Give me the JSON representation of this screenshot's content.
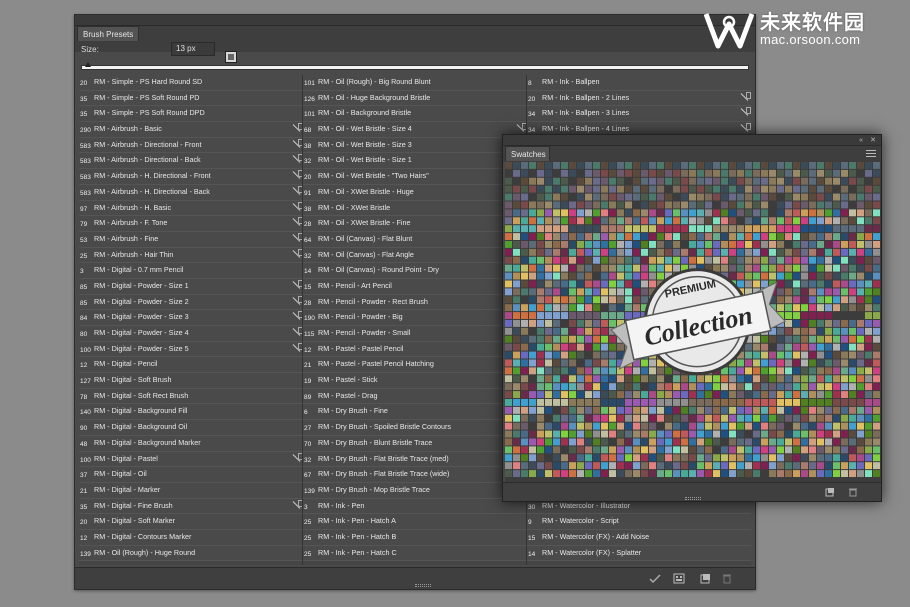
{
  "brush_panel": {
    "tab": "Brush Presets",
    "size_label": "Size:",
    "size_value": "13 px",
    "size_slider_fraction": 0.01,
    "columns": [
      [
        {
          "num": "20",
          "name": "RM - Simple - PS Hard Round SD",
          "flag": false
        },
        {
          "num": "35",
          "name": "RM - Simple - PS Soft Round PD",
          "flag": false
        },
        {
          "num": "35",
          "name": "RM - Simple - PS Soft Round DPD",
          "flag": false
        },
        {
          "num": "290",
          "name": "RM - Airbrush - Basic",
          "flag": true
        },
        {
          "num": "583",
          "name": "RM - Airbrush - Directional - Front",
          "flag": true
        },
        {
          "num": "583",
          "name": "RM - Airbrush - Directional - Back",
          "flag": true
        },
        {
          "num": "583",
          "name": "RM - Airbrush - H. Directional - Front",
          "flag": true
        },
        {
          "num": "583",
          "name": "RM - Airbrush - H. Directional - Back",
          "flag": true
        },
        {
          "num": "97",
          "name": "RM - Airbrush - H. Basic",
          "flag": true
        },
        {
          "num": "79",
          "name": "RM - Airbrush - F. Tone",
          "flag": true
        },
        {
          "num": "53",
          "name": "RM - Airbrush - Fine",
          "flag": true
        },
        {
          "num": "25",
          "name": "RM - Airbrush - Hair Thin",
          "flag": true
        },
        {
          "num": "3",
          "name": "RM - Digital - 0.7 mm Pencil",
          "flag": false
        },
        {
          "num": "85",
          "name": "RM - Digital - Powder - Size 1",
          "flag": true
        },
        {
          "num": "85",
          "name": "RM - Digital - Powder - Size 2",
          "flag": true
        },
        {
          "num": "84",
          "name": "RM - Digital - Powder - Size 3",
          "flag": true
        },
        {
          "num": "80",
          "name": "RM - Digital - Powder - Size 4",
          "flag": true
        },
        {
          "num": "100",
          "name": "RM - Digital - Powder - Size 5",
          "flag": true
        },
        {
          "num": "12",
          "name": "RM - Digital - Pencil",
          "flag": false
        },
        {
          "num": "127",
          "name": "RM - Digital - Soft Brush",
          "flag": false
        },
        {
          "num": "78",
          "name": "RM - Digital - Soft Rect Brush",
          "flag": false
        },
        {
          "num": "140",
          "name": "RM - Digital - Background Fill",
          "flag": false
        },
        {
          "num": "90",
          "name": "RM - Digital - Background Oil",
          "flag": false
        },
        {
          "num": "48",
          "name": "RM - Digital - Background Marker",
          "flag": false
        },
        {
          "num": "100",
          "name": "RM - Digital - Pastel",
          "flag": true
        },
        {
          "num": "37",
          "name": "RM - Digital - Oil",
          "flag": false
        },
        {
          "num": "21",
          "name": "RM - Digital - Marker",
          "flag": false
        },
        {
          "num": "35",
          "name": "RM - Digital - Fine Brush",
          "flag": true
        },
        {
          "num": "20",
          "name": "RM - Digital - Soft Marker",
          "flag": false
        },
        {
          "num": "12",
          "name": "RM - Digital - Contours Marker",
          "flag": false
        },
        {
          "num": "139",
          "name": "RM - Oil (Rough) - Huge Round",
          "flag": false
        }
      ],
      [
        {
          "num": "101",
          "name": "RM - Oil (Rough) - Big Round Blunt",
          "flag": false
        },
        {
          "num": "126",
          "name": "RM - Oil - Huge Background Bristle",
          "flag": false
        },
        {
          "num": "101",
          "name": "RM - Oil - Background Bristle",
          "flag": false
        },
        {
          "num": "68",
          "name": "RM - Oil - Wet Bristle - Size 4",
          "flag": true
        },
        {
          "num": "38",
          "name": "RM - Oil - Wet Bristle - Size 3",
          "flag": true
        },
        {
          "num": "32",
          "name": "RM - Oil - Wet Bristle - Size 1",
          "flag": true
        },
        {
          "num": "20",
          "name": "RM - Oil - Wet Bristle - \"Two Hairs\"",
          "flag": true
        },
        {
          "num": "91",
          "name": "RM - Oil - XWet Bristle - Huge",
          "flag": true
        },
        {
          "num": "38",
          "name": "RM - Oil - XWet Bristle",
          "flag": true
        },
        {
          "num": "28",
          "name": "RM - Oil - XWet Bristle - Fine",
          "flag": true
        },
        {
          "num": "64",
          "name": "RM - Oil (Canvas) - Flat Blunt",
          "flag": true
        },
        {
          "num": "32",
          "name": "RM - Oil (Canvas) - Flat Angle",
          "flag": true
        },
        {
          "num": "14",
          "name": "RM - Oil (Canvas) - Round Point - Dry",
          "flag": true
        },
        {
          "num": "15",
          "name": "RM - Pencil - Art Pencil",
          "flag": false
        },
        {
          "num": "28",
          "name": "RM - Pencil - Powder - Rect Brush",
          "flag": false
        },
        {
          "num": "190",
          "name": "RM - Pencil - Powder - Big",
          "flag": false
        },
        {
          "num": "115",
          "name": "RM - Pencil - Powder - Small",
          "flag": false
        },
        {
          "num": "12",
          "name": "RM - Pastel - Pastel Pencil",
          "flag": false
        },
        {
          "num": "21",
          "name": "RM - Pastel - Pastel Pencil Hatching",
          "flag": false
        },
        {
          "num": "19",
          "name": "RM - Pastel - Stick",
          "flag": false
        },
        {
          "num": "89",
          "name": "RM - Pastel - Drag",
          "flag": false
        },
        {
          "num": "6",
          "name": "RM - Dry Brush - Fine",
          "flag": false
        },
        {
          "num": "27",
          "name": "RM - Dry Brush - Spoiled Bristle Contours",
          "flag": false
        },
        {
          "num": "70",
          "name": "RM - Dry Brush - Blunt Bristle Trace",
          "flag": false
        },
        {
          "num": "32",
          "name": "RM - Dry Brush - Flat Bristle Trace (med)",
          "flag": false
        },
        {
          "num": "67",
          "name": "RM - Dry Brush - Flat Bristle Trace (wide)",
          "flag": false
        },
        {
          "num": "139",
          "name": "RM - Dry Brush - Mop Bristle Trace",
          "flag": false
        },
        {
          "num": "3",
          "name": "RM - Ink - Pen",
          "flag": false
        },
        {
          "num": "25",
          "name": "RM - Ink - Pen - Hatch A",
          "flag": false
        },
        {
          "num": "25",
          "name": "RM - Ink - Pen - Hatch B",
          "flag": false
        },
        {
          "num": "25",
          "name": "RM - Ink - Pen - Hatch C",
          "flag": false
        }
      ],
      [
        {
          "num": "8",
          "name": "RM - Ink - Ballpen",
          "flag": false
        },
        {
          "num": "20",
          "name": "RM - Ink - Ballpen - 2 Lines",
          "flag": true
        },
        {
          "num": "34",
          "name": "RM - Ink - Ballpen - 3 Lines",
          "flag": true
        },
        {
          "num": "34",
          "name": "RM - Ink - Ballpen - 4 Lines",
          "flag": true
        },
        {
          "num": "",
          "name": "",
          "flag": false
        },
        {
          "num": "",
          "name": "",
          "flag": false
        },
        {
          "num": "",
          "name": "",
          "flag": false
        },
        {
          "num": "",
          "name": "",
          "flag": false
        },
        {
          "num": "",
          "name": "",
          "flag": false
        },
        {
          "num": "",
          "name": "",
          "flag": false
        },
        {
          "num": "",
          "name": "",
          "flag": false
        },
        {
          "num": "",
          "name": "",
          "flag": false
        },
        {
          "num": "",
          "name": "",
          "flag": false
        },
        {
          "num": "",
          "name": "",
          "flag": false
        },
        {
          "num": "",
          "name": "",
          "flag": false
        },
        {
          "num": "",
          "name": "",
          "flag": false
        },
        {
          "num": "",
          "name": "",
          "flag": false
        },
        {
          "num": "",
          "name": "",
          "flag": false
        },
        {
          "num": "",
          "name": "",
          "flag": false
        },
        {
          "num": "",
          "name": "",
          "flag": false
        },
        {
          "num": "",
          "name": "",
          "flag": false
        },
        {
          "num": "",
          "name": "",
          "flag": false
        },
        {
          "num": "",
          "name": "",
          "flag": false
        },
        {
          "num": "",
          "name": "",
          "flag": false
        },
        {
          "num": "",
          "name": "",
          "flag": false
        },
        {
          "num": "",
          "name": "",
          "flag": false
        },
        {
          "num": "",
          "name": "",
          "flag": false
        },
        {
          "num": "30",
          "name": "RM - Watercolor - Illustrator",
          "flag": false
        },
        {
          "num": "9",
          "name": "RM - Watercolor - Script",
          "flag": false
        },
        {
          "num": "15",
          "name": "RM - Watercolor (FX) - Add Noise",
          "flag": false
        },
        {
          "num": "14",
          "name": "RM - Watercolor (FX) - Splatter",
          "flag": false
        }
      ]
    ],
    "bottom_icons": [
      "brush-toggle-icon",
      "grid-view-icon",
      "new-preset-icon",
      "trash-icon"
    ]
  },
  "swatches_panel": {
    "tab": "Swatches",
    "controls": [
      "«",
      "✕"
    ],
    "palette_colors": [
      "#5a4a3c",
      "#7a6b5a",
      "#4b5a4a",
      "#3c4b5a",
      "#6b5a6b",
      "#8a7a5a",
      "#5a6b7a",
      "#3c3c3c",
      "#7a4a4a",
      "#4a7a6b",
      "#9a8a6a",
      "#6a6a8a",
      "#8a6a4a",
      "#4a6a8a",
      "#aa7a6a",
      "#6aaa8a",
      "#2a4a6a",
      "#6a2a4a",
      "#8aaa4a",
      "#aa4a8a",
      "#4aaa9a",
      "#caa05a",
      "#5a90c0",
      "#c05a5a",
      "#6ac06a",
      "#c0c06a",
      "#6a6ac0",
      "#9a5ab0",
      "#b0905a",
      "#5ab0b0",
      "#d07040",
      "#40a0d0",
      "#d04080",
      "#80d040",
      "#e0c060",
      "#3070a0",
      "#a03050",
      "#50a030",
      "#909090",
      "#b0b0b0",
      "#d0a080",
      "#80a0d0",
      "#c0c0a0",
      "#205080",
      "#802050",
      "#508020",
      "#e08080",
      "#80e0c0"
    ],
    "menu_icon": "panel-menu-icon",
    "bottom_icons": [
      "new-swatch-icon",
      "trash-icon"
    ]
  },
  "badge": {
    "line1": "PREMIUM",
    "line2": "Collection"
  },
  "watermark": {
    "title": "未来软件园",
    "url": "mac.orsoon.com"
  }
}
